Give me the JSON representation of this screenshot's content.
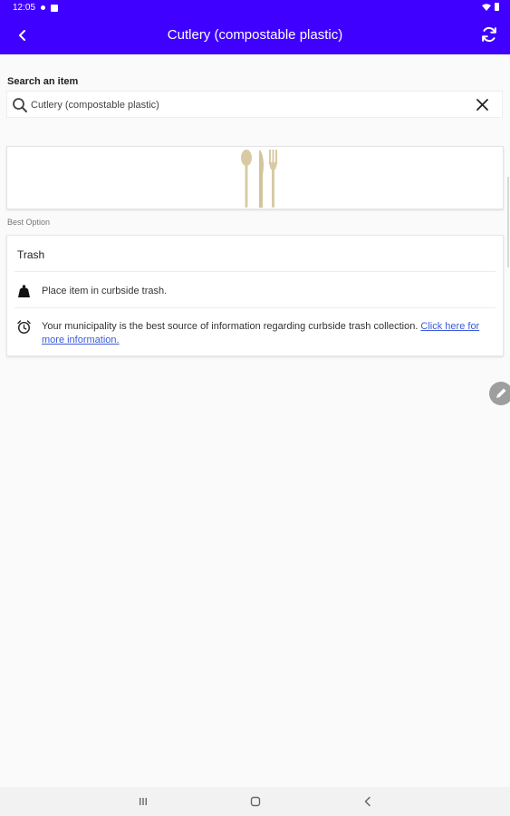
{
  "status_bar": {
    "time": "12:05"
  },
  "app_bar": {
    "title": "Cutlery (compostable plastic)"
  },
  "search": {
    "label": "Search an item",
    "value": "Cutlery (compostable plastic)",
    "placeholder": "Search an item"
  },
  "best_option_label": "Best Option",
  "result": {
    "heading": "Trash",
    "instruction": "Place item in curbside trash.",
    "info_text": "Your municipality is the best source of information regarding curbside trash collection. ",
    "info_link": "Click here for more information."
  },
  "colors": {
    "brand": "#3f00ff",
    "link": "#3b5bdb",
    "fab": "#9e9e9e"
  },
  "icons": {
    "back": "chevron-left-icon",
    "refresh": "refresh-icon",
    "search": "search-icon",
    "clear": "close-icon",
    "trash": "trash-bin-icon",
    "info": "alarm-clock-icon",
    "edit": "pencil-icon"
  }
}
